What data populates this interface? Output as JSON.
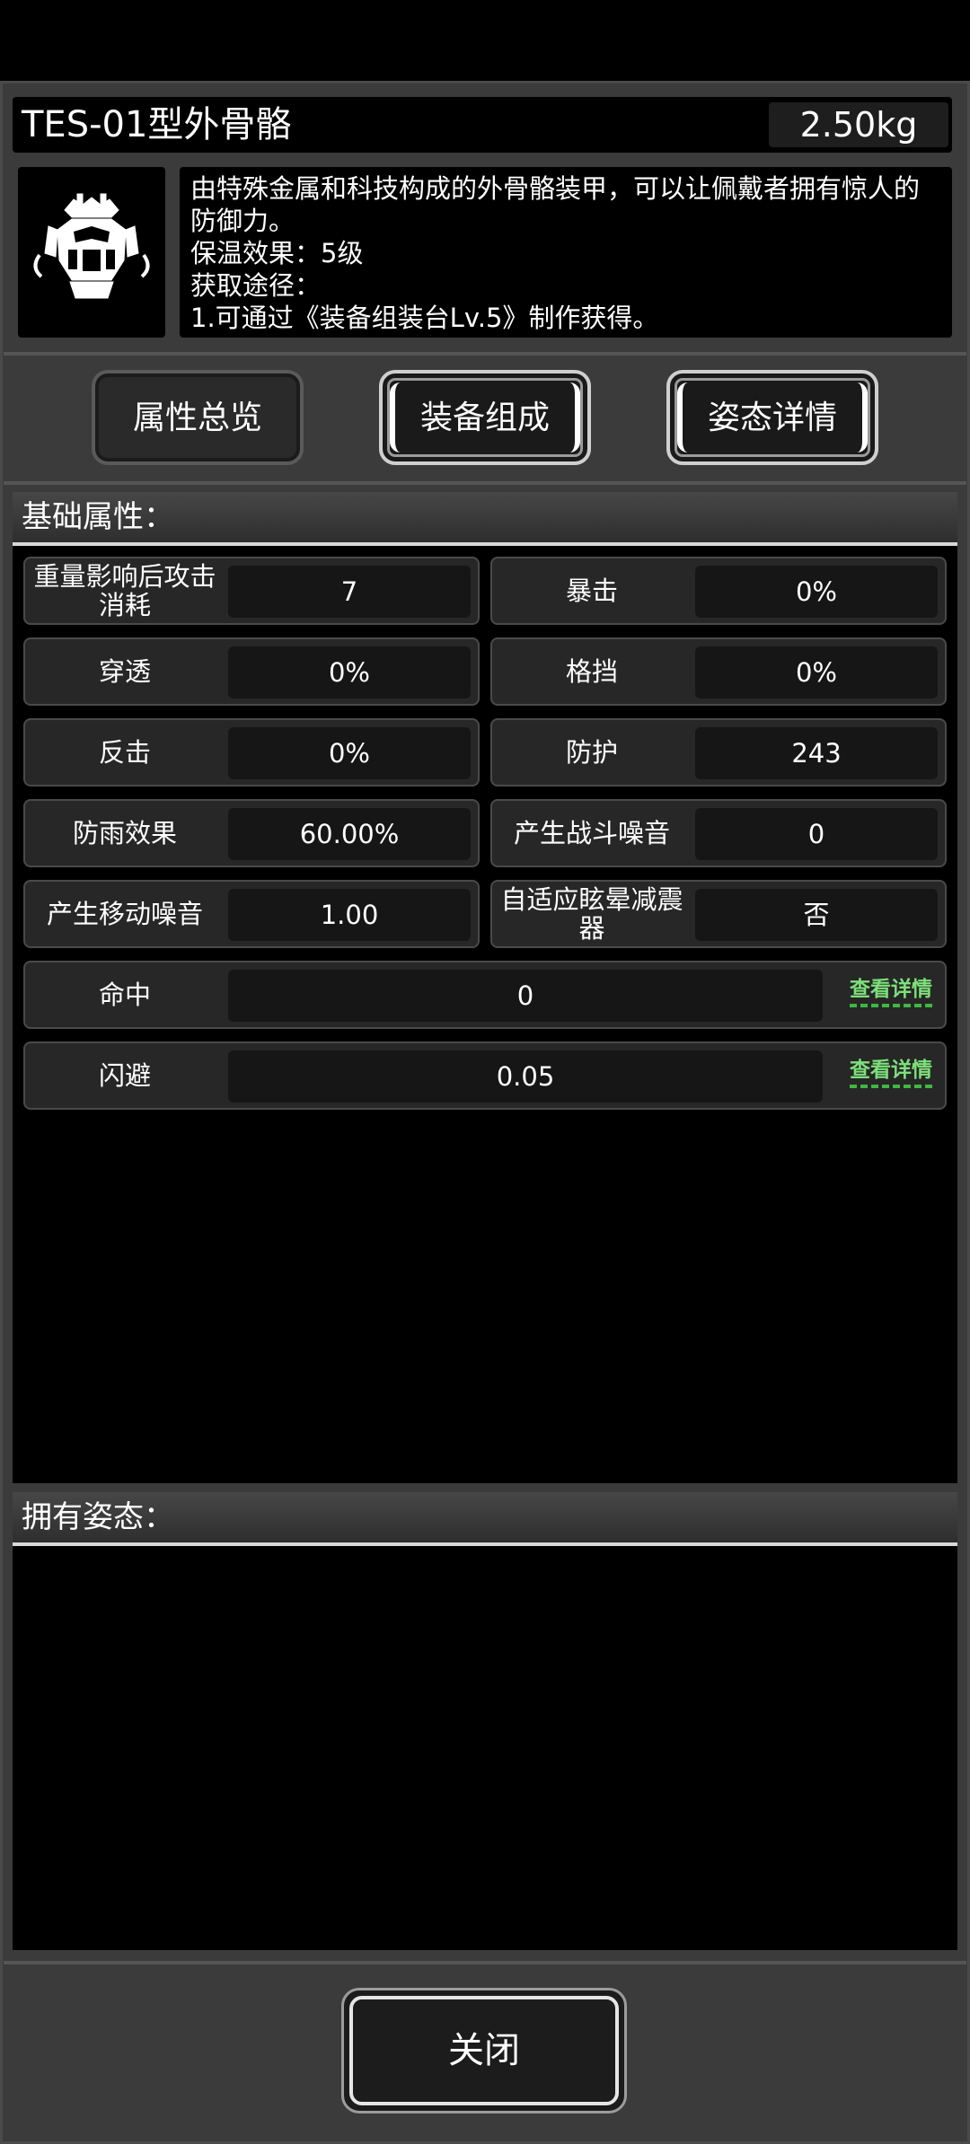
{
  "item": {
    "name": "TES-01型外骨骼",
    "weight": "2.50kg",
    "icon": "exoskeleton-armor-icon",
    "description": [
      "由特殊金属和科技构成的外骨骼装甲，可以让佩戴者拥有惊人的",
      "防御力。",
      "保温效果：5级",
      "获取途径：",
      "1.可通过《装备组装台Lv.5》制作获得。"
    ]
  },
  "tabs": [
    {
      "label": "属性总览",
      "active": true
    },
    {
      "label": "装备组成",
      "active": false
    },
    {
      "label": "姿态详情",
      "active": false
    }
  ],
  "base_attributes": {
    "title": "基础属性：",
    "pairs": [
      {
        "left": {
          "label": "重量影响后攻击消耗",
          "value": "7"
        },
        "right": {
          "label": "暴击",
          "value": "0%"
        }
      },
      {
        "left": {
          "label": "穿透",
          "value": "0%"
        },
        "right": {
          "label": "格挡",
          "value": "0%"
        }
      },
      {
        "left": {
          "label": "反击",
          "value": "0%"
        },
        "right": {
          "label": "防护",
          "value": "243"
        }
      },
      {
        "left": {
          "label": "防雨效果",
          "value": "60.00%"
        },
        "right": {
          "label": "产生战斗噪音",
          "value": "0"
        }
      },
      {
        "left": {
          "label": "产生移动噪音",
          "value": "1.00"
        },
        "right": {
          "label": "自适应眩晕减震器",
          "value": "否"
        }
      }
    ],
    "wide": [
      {
        "label": "命中",
        "value": "0",
        "link": "查看详情"
      },
      {
        "label": "闪避",
        "value": "0.05",
        "link": "查看详情"
      }
    ]
  },
  "stances": {
    "title": "拥有姿态："
  },
  "close_label": "关闭"
}
